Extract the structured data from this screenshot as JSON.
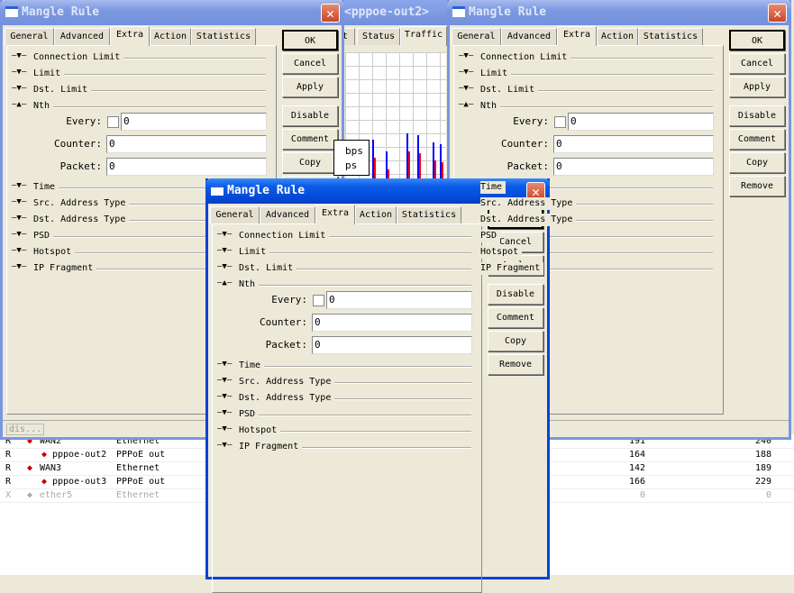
{
  "background_window": {
    "title": "<pppoe-out2>",
    "tabs": [
      "t",
      "Status",
      "Traffic"
    ],
    "legend": [
      "bps",
      "ps"
    ]
  },
  "interfaces": [
    {
      "flag": "R",
      "name": "WAN2",
      "type": "Ethernet",
      "tx": "191",
      "rx": "240",
      "indent": false,
      "disabled": false
    },
    {
      "flag": "R",
      "name": "pppoe-out2",
      "type": "PPPoE out",
      "tx": "164",
      "rx": "188",
      "indent": true,
      "disabled": false
    },
    {
      "flag": "R",
      "name": "WAN3",
      "type": "Ethernet",
      "tx": "142",
      "rx": "189",
      "indent": false,
      "disabled": false
    },
    {
      "flag": "R",
      "name": "pppoe-out3",
      "type": "PPPoE out",
      "tx": "166",
      "rx": "229",
      "indent": true,
      "disabled": false
    },
    {
      "flag": "X",
      "name": "ether5",
      "type": "Ethernet",
      "tx": "0",
      "rx": "0",
      "indent": false,
      "disabled": true
    }
  ],
  "dialog": {
    "title": "Mangle Rule",
    "close": "✕",
    "tabs": [
      "General",
      "Advanced",
      "Extra",
      "Action",
      "Statistics"
    ],
    "active_tab": "Extra",
    "sections_top": [
      {
        "label": "Connection Limit",
        "expanded": false
      },
      {
        "label": "Limit",
        "expanded": false
      },
      {
        "label": "Dst. Limit",
        "expanded": false
      },
      {
        "label": "Nth",
        "expanded": true
      }
    ],
    "fields": {
      "every_label": "Every:",
      "every_value": "0",
      "counter_label": "Counter:",
      "counter_value": "0",
      "packet_label": "Packet:",
      "packet_value": "0"
    },
    "sections_bottom": [
      {
        "label": "Time",
        "expanded": false
      },
      {
        "label": "Src. Address Type",
        "expanded": false
      },
      {
        "label": "Dst. Address Type",
        "expanded": false
      },
      {
        "label": "PSD",
        "expanded": false
      },
      {
        "label": "Hotspot",
        "expanded": false
      },
      {
        "label": "IP Fragment",
        "expanded": false
      }
    ],
    "buttons": [
      "OK",
      "Cancel",
      "Apply",
      "Disable",
      "Comment",
      "Copy",
      "Remove"
    ],
    "status": "dis..."
  },
  "colors": {
    "active_title": "#0448d6",
    "inactive_title": "#7b98e0",
    "close": "#c9462a",
    "tx_bar": "#0000ff",
    "rx_bar": "#ff0000"
  }
}
